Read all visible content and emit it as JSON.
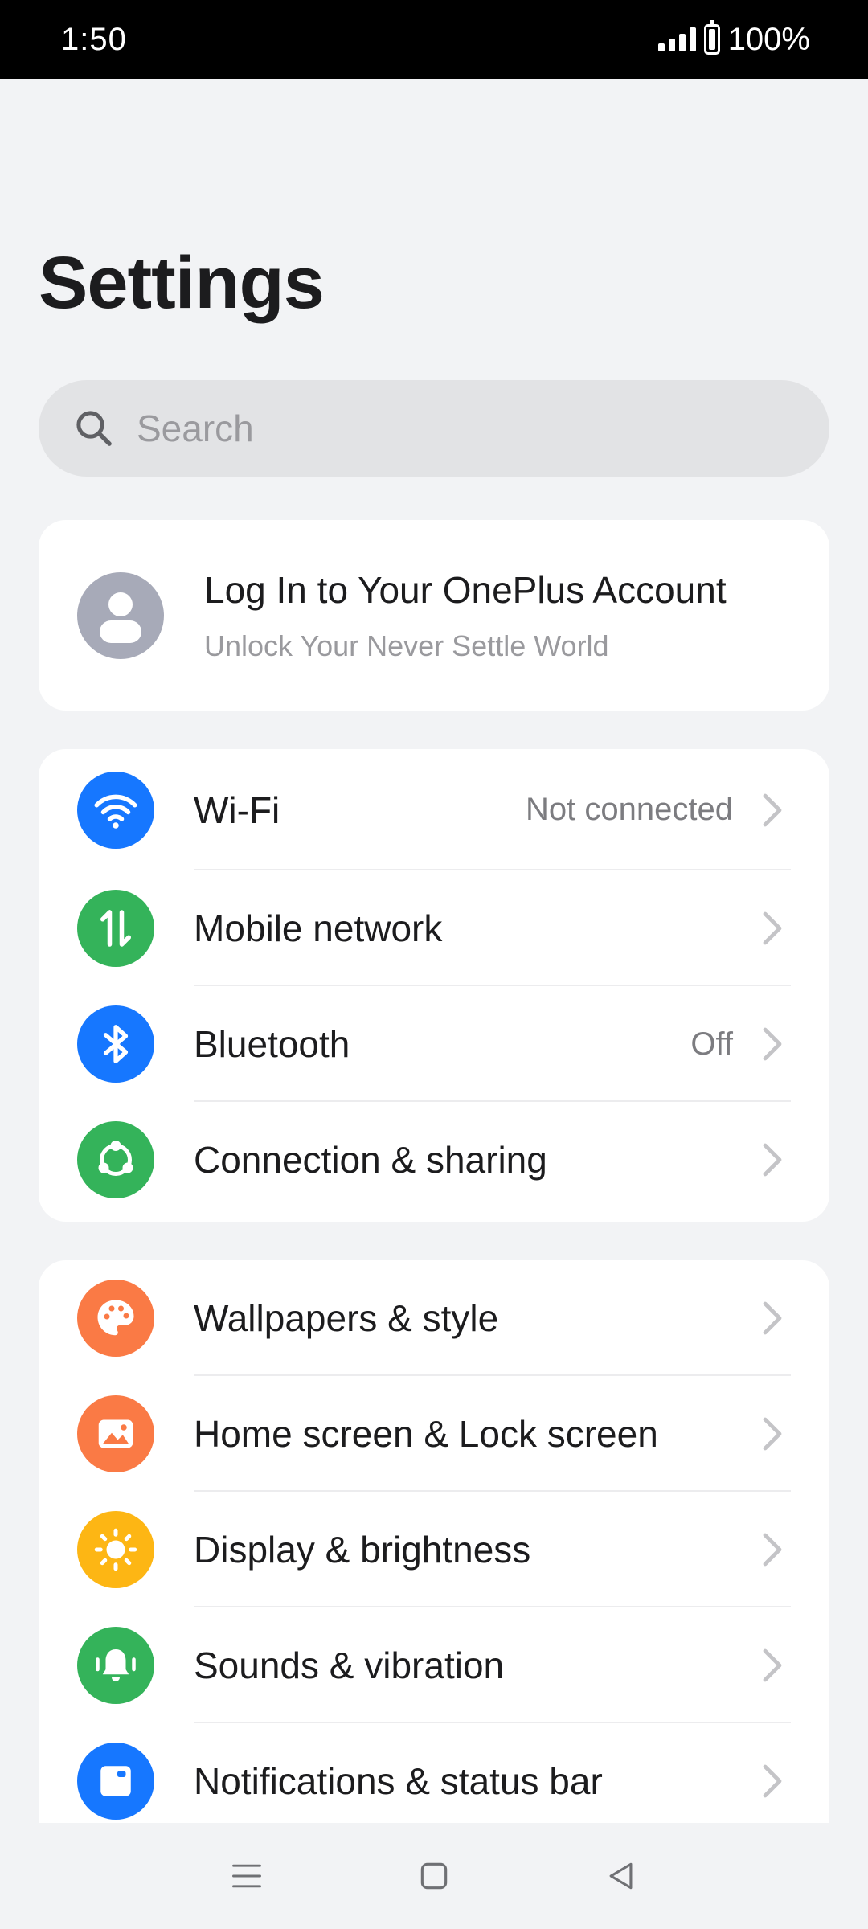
{
  "status_bar": {
    "time": "1:50",
    "battery": "100%"
  },
  "page": {
    "title": "Settings"
  },
  "search": {
    "placeholder": "Search",
    "value": ""
  },
  "account": {
    "title": "Log In to Your OnePlus Account",
    "subtitle": "Unlock Your Never Settle World"
  },
  "connectivity": [
    {
      "label": "Wi-Fi",
      "value": "Not connected",
      "icon": "wifi-icon",
      "color": "#1677ff"
    },
    {
      "label": "Mobile network",
      "value": "",
      "icon": "mobile-data-icon",
      "color": "#34b35a"
    },
    {
      "label": "Bluetooth",
      "value": "Off",
      "icon": "bluetooth-icon",
      "color": "#1677ff"
    },
    {
      "label": "Connection & sharing",
      "value": "",
      "icon": "share-icon",
      "color": "#34b35a"
    }
  ],
  "personalization": [
    {
      "label": "Wallpapers & style",
      "icon": "palette-icon",
      "color": "#fa7a45"
    },
    {
      "label": "Home screen & Lock screen",
      "icon": "image-icon",
      "color": "#fa7a45"
    },
    {
      "label": "Display & brightness",
      "icon": "sun-icon",
      "color": "#fdb614"
    },
    {
      "label": "Sounds & vibration",
      "icon": "bell-icon",
      "color": "#34b35a"
    },
    {
      "label": "Notifications & status bar",
      "icon": "notification-icon",
      "color": "#1677ff"
    }
  ],
  "nav_bar": {
    "items": [
      "menu-icon",
      "home-icon",
      "back-icon"
    ]
  }
}
